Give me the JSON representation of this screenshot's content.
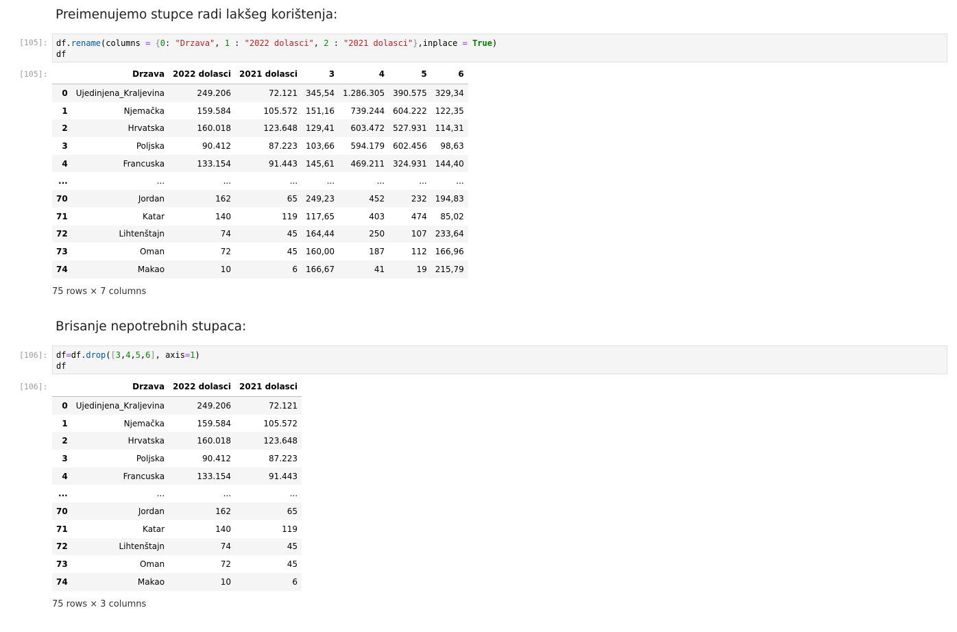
{
  "cells": {
    "md1": "Preimenujemo stupce radi lakšeg korištenja:",
    "prompt105_in": "[105]:",
    "prompt105_out": "[105]:",
    "md2": "Brisanje nepotrebnih stupaca:",
    "prompt106_in": "[106]:",
    "prompt106_out": "[106]:"
  },
  "code105": {
    "line1": [
      {
        "t": "df",
        "c": "var"
      },
      {
        "t": ".",
        "c": "var"
      },
      {
        "t": "rename",
        "c": "fn"
      },
      {
        "t": "(",
        "c": "br"
      },
      {
        "t": "columns ",
        "c": "var"
      },
      {
        "t": "=",
        "c": "op"
      },
      {
        "t": " ",
        "c": "var"
      },
      {
        "t": "{",
        "c": "brc"
      },
      {
        "t": "0",
        "c": "num"
      },
      {
        "t": ": ",
        "c": "var"
      },
      {
        "t": "\"Drzava\"",
        "c": "str"
      },
      {
        "t": ", ",
        "c": "var"
      },
      {
        "t": "1",
        "c": "num"
      },
      {
        "t": " : ",
        "c": "var"
      },
      {
        "t": "\"2022 dolasci\"",
        "c": "str"
      },
      {
        "t": ", ",
        "c": "var"
      },
      {
        "t": "2",
        "c": "num"
      },
      {
        "t": " : ",
        "c": "var"
      },
      {
        "t": "\"2021 dolasci\"",
        "c": "str"
      },
      {
        "t": "}",
        "c": "brc"
      },
      {
        "t": ",inplace ",
        "c": "var"
      },
      {
        "t": "=",
        "c": "op"
      },
      {
        "t": " ",
        "c": "var"
      },
      {
        "t": "True",
        "c": "kw"
      },
      {
        "t": ")",
        "c": "br"
      }
    ],
    "line2": [
      {
        "t": "df",
        "c": "var"
      }
    ]
  },
  "code106": {
    "line1": [
      {
        "t": "df",
        "c": "var"
      },
      {
        "t": "=",
        "c": "op"
      },
      {
        "t": "df",
        "c": "var"
      },
      {
        "t": ".",
        "c": "var"
      },
      {
        "t": "drop",
        "c": "fn"
      },
      {
        "t": "(",
        "c": "br"
      },
      {
        "t": "[",
        "c": "brc"
      },
      {
        "t": "3",
        "c": "num"
      },
      {
        "t": ",",
        "c": "var"
      },
      {
        "t": "4",
        "c": "num"
      },
      {
        "t": ",",
        "c": "var"
      },
      {
        "t": "5",
        "c": "num"
      },
      {
        "t": ",",
        "c": "var"
      },
      {
        "t": "6",
        "c": "num"
      },
      {
        "t": "]",
        "c": "brc"
      },
      {
        "t": ", axis",
        "c": "var"
      },
      {
        "t": "=",
        "c": "op"
      },
      {
        "t": "1",
        "c": "num"
      },
      {
        "t": ")",
        "c": "br"
      }
    ],
    "line2": [
      {
        "t": "df",
        "c": "var"
      }
    ]
  },
  "table1": {
    "columns": [
      "",
      "Drzava",
      "2022 dolasci",
      "2021 dolasci",
      "3",
      "4",
      "5",
      "6"
    ],
    "rows": [
      [
        "0",
        "Ujedinjena_Kraljevina",
        "249.206",
        "72.121",
        "345,54",
        "1.286.305",
        "390.575",
        "329,34"
      ],
      [
        "1",
        "Njemačka",
        "159.584",
        "105.572",
        "151,16",
        "739.244",
        "604.222",
        "122,35"
      ],
      [
        "2",
        "Hrvatska",
        "160.018",
        "123.648",
        "129,41",
        "603.472",
        "527.931",
        "114,31"
      ],
      [
        "3",
        "Poljska",
        "90.412",
        "87.223",
        "103,66",
        "594.179",
        "602.456",
        "98,63"
      ],
      [
        "4",
        "Francuska",
        "133.154",
        "91.443",
        "145,61",
        "469.211",
        "324.931",
        "144,40"
      ],
      [
        "...",
        "...",
        "...",
        "...",
        "...",
        "...",
        "...",
        "..."
      ],
      [
        "70",
        "Jordan",
        "162",
        "65",
        "249,23",
        "452",
        "232",
        "194,83"
      ],
      [
        "71",
        "Katar",
        "140",
        "119",
        "117,65",
        "403",
        "474",
        "85,02"
      ],
      [
        "72",
        "Lihtenštajn",
        "74",
        "45",
        "164,44",
        "250",
        "107",
        "233,64"
      ],
      [
        "73",
        "Oman",
        "72",
        "45",
        "160,00",
        "187",
        "112",
        "166,96"
      ],
      [
        "74",
        "Makao",
        "10",
        "6",
        "166,67",
        "41",
        "19",
        "215,79"
      ]
    ],
    "shape": "75 rows × 7 columns"
  },
  "table2": {
    "columns": [
      "",
      "Drzava",
      "2022 dolasci",
      "2021 dolasci"
    ],
    "rows": [
      [
        "0",
        "Ujedinjena_Kraljevina",
        "249.206",
        "72.121"
      ],
      [
        "1",
        "Njemačka",
        "159.584",
        "105.572"
      ],
      [
        "2",
        "Hrvatska",
        "160.018",
        "123.648"
      ],
      [
        "3",
        "Poljska",
        "90.412",
        "87.223"
      ],
      [
        "4",
        "Francuska",
        "133.154",
        "91.443"
      ],
      [
        "...",
        "...",
        "...",
        "..."
      ],
      [
        "70",
        "Jordan",
        "162",
        "65"
      ],
      [
        "71",
        "Katar",
        "140",
        "119"
      ],
      [
        "72",
        "Lihtenštajn",
        "74",
        "45"
      ],
      [
        "73",
        "Oman",
        "72",
        "45"
      ],
      [
        "74",
        "Makao",
        "10",
        "6"
      ]
    ],
    "shape": "75 rows × 3 columns"
  }
}
